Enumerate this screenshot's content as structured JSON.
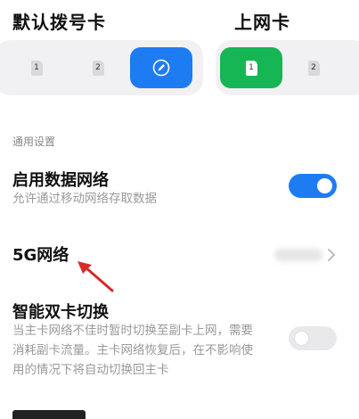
{
  "dial_card": {
    "title": "默认拨号卡",
    "options": [
      "1",
      "2"
    ],
    "selected_icon": "edit-icon",
    "accent": "#1e7cf2"
  },
  "data_card": {
    "title": "上网卡",
    "options": [
      "1",
      "2"
    ],
    "accent": "#17b654"
  },
  "general": {
    "group_label": "通用设置",
    "mobile_data": {
      "title": "启用数据网络",
      "desc": "允许通过移动网络存取数据",
      "enabled": true
    },
    "network_5g": {
      "title": "5G网络"
    },
    "smart_dual": {
      "title": "智能双卡切换",
      "desc": "当主卡网络不佳时暂时切换至副卡上网，需要消耗副卡流量。主卡网络恢复后，在不影响使用的情况下将自动切换回主卡",
      "enabled": false
    }
  },
  "annotation": {
    "color": "#d62b2b"
  }
}
